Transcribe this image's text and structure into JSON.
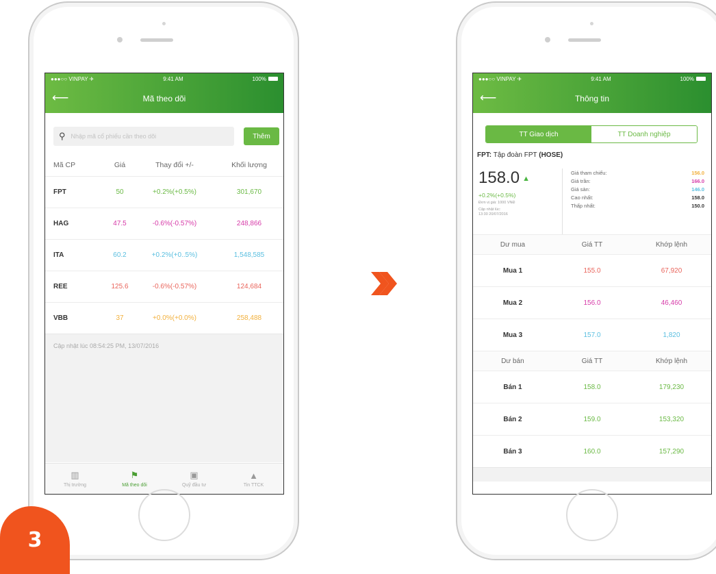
{
  "colors": {
    "brand_green": "#6ab944",
    "header_gradient_start": "#6dbb43",
    "header_gradient_end": "#2b8f2f",
    "up_green": "#6ab944",
    "magenta": "#d63aa8",
    "cyan": "#5bbfe0",
    "red": "#e9645b",
    "orange": "#f2b03c",
    "badge_orange": "#f0541e"
  },
  "left_phone": {
    "status": {
      "carrier": "●●●○○ VINPAY ✈",
      "time": "9:41 AM",
      "battery": "100%"
    },
    "header": {
      "back_icon": "arrow-left-icon",
      "title": "Mã theo dõi"
    },
    "search": {
      "icon": "search-icon",
      "placeholder": "Nhập mã cổ phiếu cần theo dõi",
      "button_label": "Thêm"
    },
    "table": {
      "headers": [
        "Mã CP",
        "Giá",
        "Thay đổi +/-",
        "Khối lượng"
      ],
      "rows": [
        {
          "code": "FPT",
          "price": "50",
          "change": "+0.2%(+0.5%)",
          "volume": "301,670",
          "color": "#6ab944"
        },
        {
          "code": "HAG",
          "price": "47.5",
          "change": "-0.6%(-0.57%)",
          "volume": "248,866",
          "color": "#d63aa8"
        },
        {
          "code": "ITA",
          "price": "60.2",
          "change": "+0.2%(+0..5%)",
          "volume": "1,548,585",
          "color": "#5bbfe0"
        },
        {
          "code": "REE",
          "price": "125.6",
          "change": "-0.6%(-0.57%)",
          "volume": "124,684",
          "color": "#e9645b"
        },
        {
          "code": "VBB",
          "price": "37",
          "change": "+0.0%(+0.0%)",
          "volume": "258,488",
          "color": "#f2b03c"
        }
      ]
    },
    "updated_text": "Cập nhật lúc 08:54:25 PM, 13/07/2016",
    "tabs": [
      {
        "label": "Thị trường",
        "icon": "chart-icon",
        "active": false
      },
      {
        "label": "Mã theo dõi",
        "icon": "flag-icon",
        "active": true
      },
      {
        "label": "Quỹ đầu tư",
        "icon": "briefcase-icon",
        "active": false
      },
      {
        "label": "Tin TTCK",
        "icon": "megaphone-icon",
        "active": false
      }
    ]
  },
  "right_phone": {
    "status": {
      "carrier": "●●●○○ VINPAY ✈",
      "time": "9:41 AM",
      "battery": "100%"
    },
    "header": {
      "back_icon": "arrow-left-icon",
      "title": "Thông tin"
    },
    "segments": [
      "TT Giao dịch",
      "TT Doanh nghiệp"
    ],
    "company": {
      "code": "FPT:",
      "name": " Tập đoàn FPT ",
      "exchange": "(HOSE)"
    },
    "quote": {
      "price": "158.0",
      "arrow": "▲",
      "change": "+0.2%(+0.5%)",
      "unit_note": "Đơn vị giá: 1000 VNĐ",
      "update_label": "Cập nhật lúc:",
      "update_time": "13:30 20/07/2016",
      "refs": [
        {
          "label": "Giá tham chiếu:",
          "value": "156.0",
          "color": "#f2b03c"
        },
        {
          "label": "Giá trần:",
          "value": "166.0",
          "color": "#d63aa8"
        },
        {
          "label": "Giá sàn:",
          "value": "146.0",
          "color": "#5bbfe0"
        },
        {
          "label": "Cao nhất:",
          "value": "158.0",
          "color": "#333333"
        },
        {
          "label": "Thấp nhất:",
          "value": "150.0",
          "color": "#333333"
        }
      ]
    },
    "buy": {
      "headers": [
        "Dư mua",
        "Giá TT",
        "Khớp lệnh"
      ],
      "rows": [
        {
          "label": "Mua 1",
          "price": "155.0",
          "volume": "67,920",
          "color": "#e9645b"
        },
        {
          "label": "Mua 2",
          "price": "156.0",
          "volume": "46,460",
          "color": "#d63aa8"
        },
        {
          "label": "Mua 3",
          "price": "157.0",
          "volume": "1,820",
          "color": "#5bbfe0"
        }
      ]
    },
    "sell": {
      "headers": [
        "Dư bán",
        "Giá TT",
        "Khớp lệnh"
      ],
      "rows": [
        {
          "label": "Bán 1",
          "price": "158.0",
          "volume": "179,230",
          "color": "#6ab944"
        },
        {
          "label": "Bán 2",
          "price": "159.0",
          "volume": "153,320",
          "color": "#6ab944"
        },
        {
          "label": "Bán 3",
          "price": "160.0",
          "volume": "157,290",
          "color": "#6ab944"
        }
      ]
    }
  },
  "arrow_icon": "double-chevron-right-icon",
  "step_badge": "3"
}
